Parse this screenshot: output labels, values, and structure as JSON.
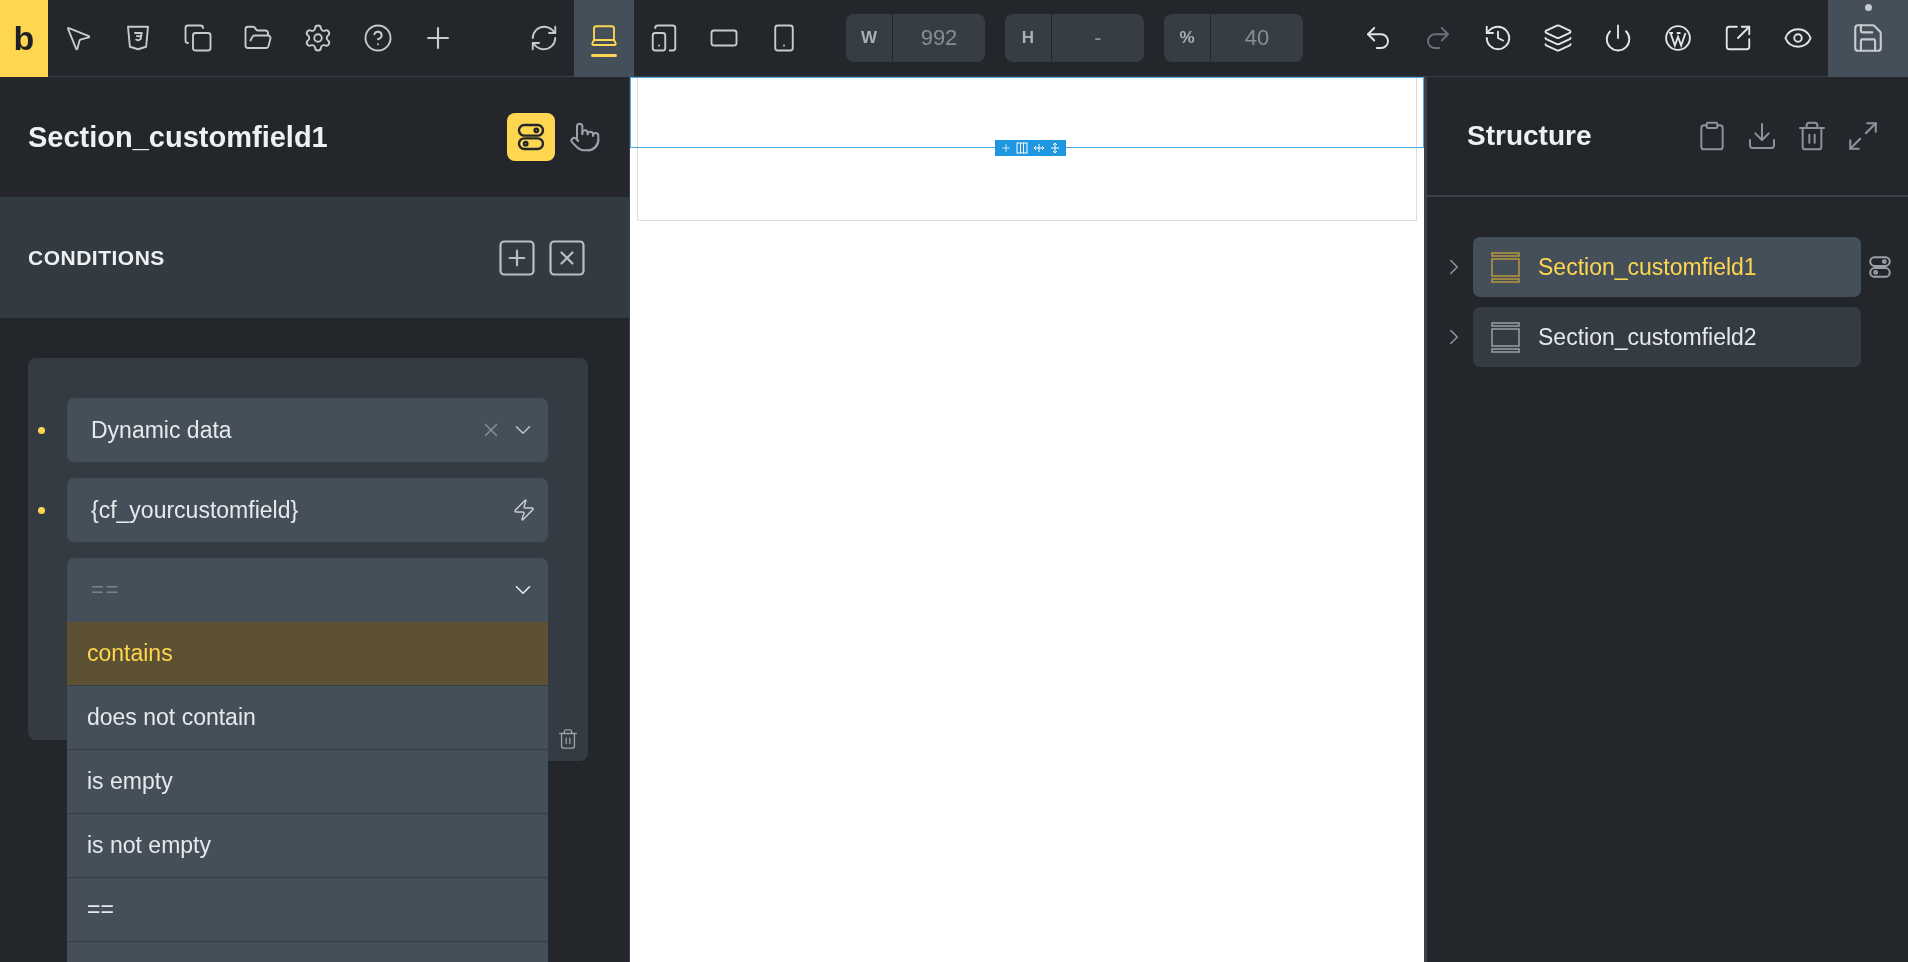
{
  "toolbar": {
    "logo": "b",
    "tools": [
      {
        "kind": "pointer"
      },
      {
        "kind": "css"
      },
      {
        "kind": "pages"
      },
      {
        "kind": "folder"
      },
      {
        "kind": "settings"
      },
      {
        "kind": "help"
      },
      {
        "kind": "add"
      }
    ],
    "devices": [
      {
        "kind": "laptop",
        "selected": true
      },
      {
        "kind": "tablet-landscape",
        "selected": false
      },
      {
        "kind": "tablet",
        "selected": false
      },
      {
        "kind": "phone",
        "selected": false
      }
    ],
    "size_fields": [
      {
        "label": "W",
        "placeholder": "992"
      },
      {
        "label": "H",
        "placeholder": "-"
      },
      {
        "label": "%",
        "placeholder": "40"
      }
    ],
    "actions": [
      {
        "kind": "undo",
        "disabled": false
      },
      {
        "kind": "redo",
        "disabled": true
      },
      {
        "kind": "history",
        "disabled": false
      },
      {
        "kind": "layers",
        "disabled": false
      },
      {
        "kind": "power",
        "disabled": false
      },
      {
        "kind": "wordpress",
        "disabled": false
      },
      {
        "kind": "external",
        "disabled": false
      },
      {
        "kind": "preview",
        "disabled": false
      }
    ]
  },
  "panel": {
    "title": "Section_customfield1",
    "conditions_title": "CONDITIONS",
    "fields": [
      {
        "kind": "select",
        "value": "Dynamic data"
      },
      {
        "kind": "dynamic",
        "value": "{cf_yourcustomfield}"
      }
    ],
    "operator": {
      "placeholder": "=="
    },
    "options": [
      {
        "label": "contains",
        "selected": true
      },
      {
        "label": "does not contain",
        "selected": false
      },
      {
        "label": "is empty",
        "selected": false
      },
      {
        "label": "is not empty",
        "selected": false
      },
      {
        "label": "==",
        "selected": false
      }
    ]
  },
  "structure": {
    "title": "Structure",
    "items": [
      {
        "label": "Section_customfield1",
        "selected": true
      },
      {
        "label": "Section_customfield2",
        "selected": false
      }
    ]
  }
}
